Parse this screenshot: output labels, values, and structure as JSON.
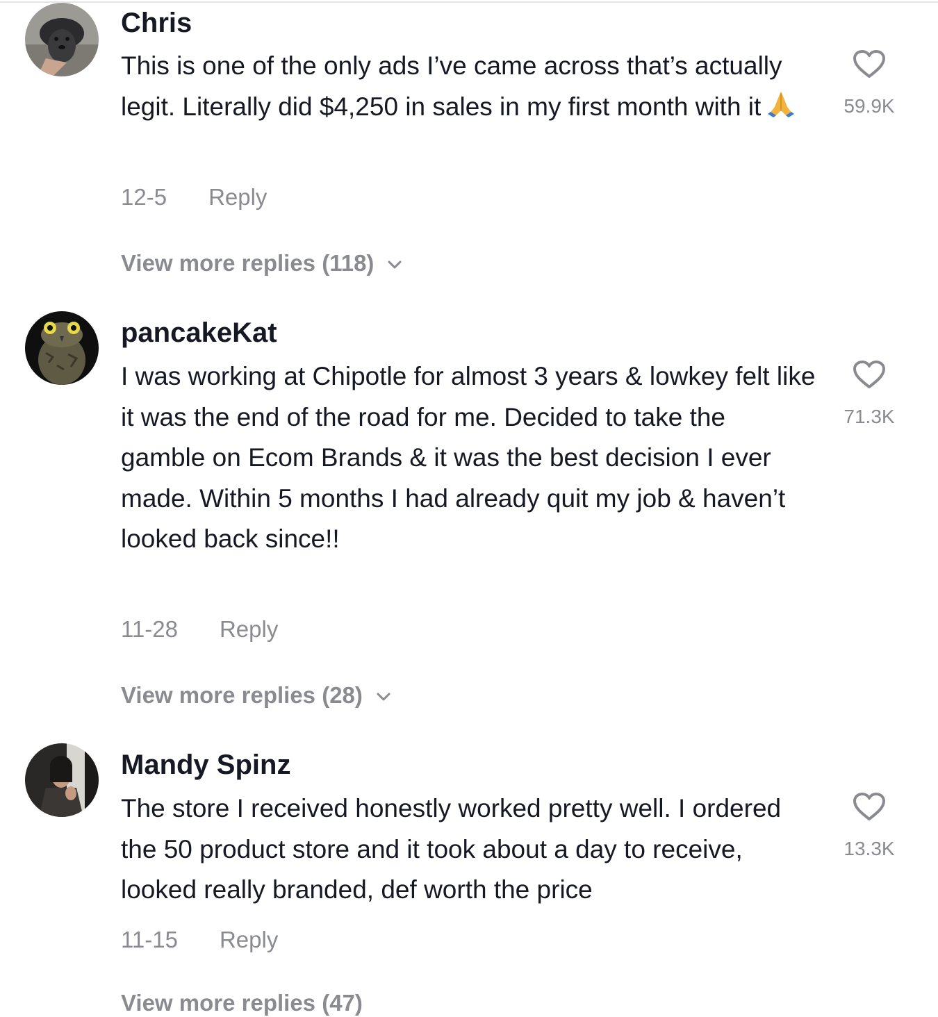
{
  "colors": {
    "text": "#161823",
    "muted": "#8a8b91",
    "background": "#ffffff"
  },
  "comments": [
    {
      "username": "Chris",
      "text": "This is one of the only ads I’ve came across that’s actually legit. Literally did $4,250 in sales in my first month with it",
      "emoji": "folded-hands",
      "date": "12-5",
      "reply_label": "Reply",
      "likes": "59.9K",
      "view_more": "View more replies (118)"
    },
    {
      "username": "pancakeKat",
      "text": "I was working at Chipotle for almost 3 years & lowkey felt like it was the end of the road for me. Decided to take the gamble on Ecom Brands & it was the best decision I ever made. Within 5 months I had already quit my job & haven’t looked back since!!",
      "date": "11-28",
      "reply_label": "Reply",
      "likes": "71.3K",
      "view_more": "View more replies (28)"
    },
    {
      "username": "Mandy Spinz",
      "text": "The store I received honestly worked pretty well. I ordered the 50 product store and it took about a day to receive, looked really branded, def worth the price",
      "date": "11-15",
      "reply_label": "Reply",
      "likes": "13.3K",
      "view_more": "View more replies (47)"
    }
  ]
}
